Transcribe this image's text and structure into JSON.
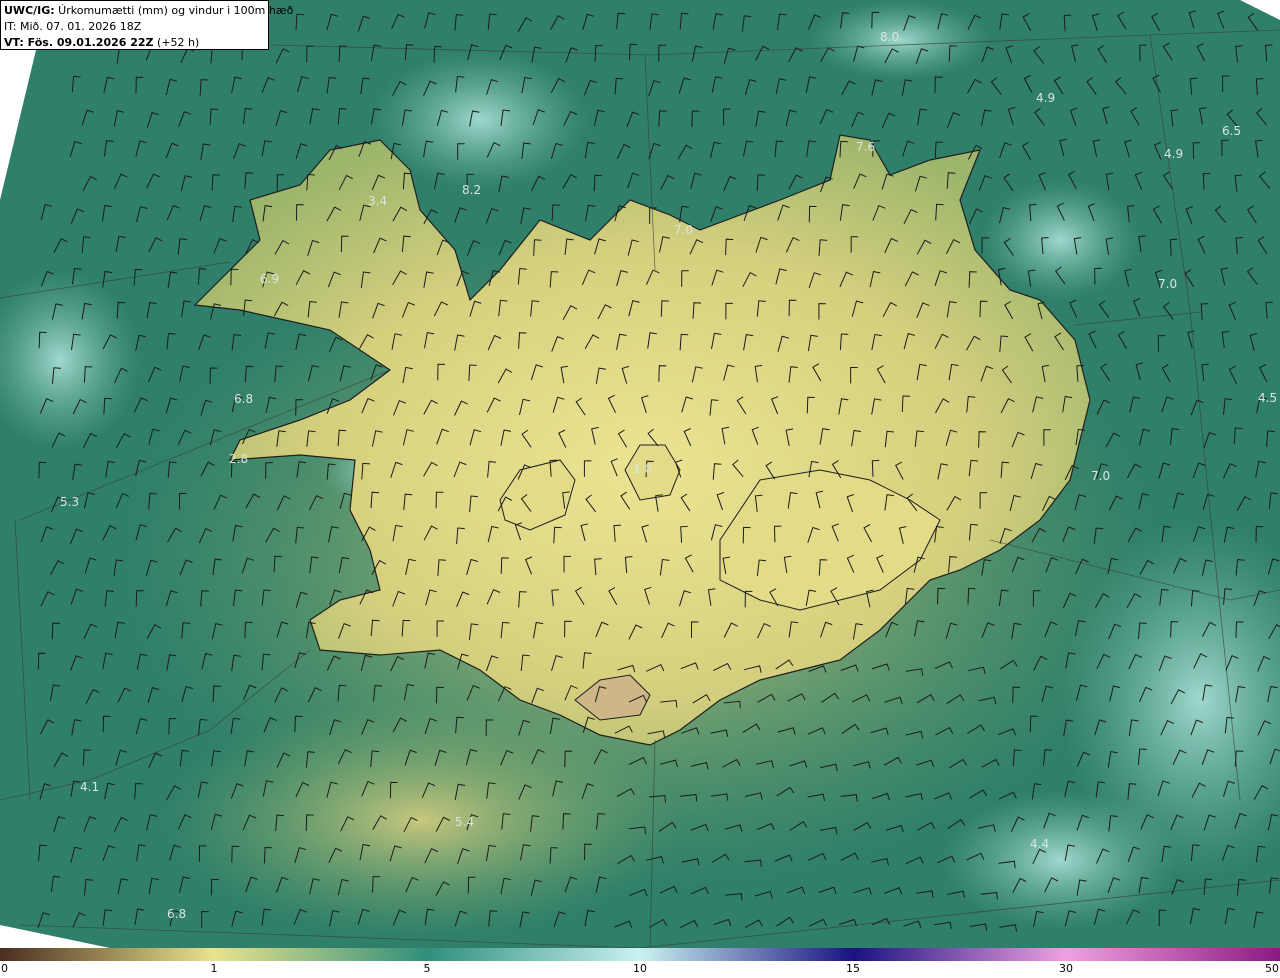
{
  "header": {
    "line1_bold": "UWC/IG:",
    "line1_text": " Úrkomumætti (mm) og vindur i 100m hæð",
    "line2": "IT: Mið. 07. 01. 2026 18Z",
    "line3_bold": "VT: Fös. 09.01.2026 22Z",
    "line3_text": " (+52 h)"
  },
  "colors": {
    "sea": "#2f7f6a",
    "land_low": "#c9c77a",
    "land_high": "#e9e38e",
    "cloud": "#8fd0c4",
    "outline": "#1e1e1e"
  },
  "map_labels": [
    {
      "text": "8.0"
    },
    {
      "text": "4.9"
    },
    {
      "text": "6.5"
    },
    {
      "text": "4.9"
    },
    {
      "text": "7.6"
    },
    {
      "text": "3.4"
    },
    {
      "text": "8.2"
    },
    {
      "text": "7.0"
    },
    {
      "text": "6.9"
    },
    {
      "text": "7.0"
    },
    {
      "text": "6.8"
    },
    {
      "text": "4.5"
    },
    {
      "text": "2.8"
    },
    {
      "text": "1.0"
    },
    {
      "text": "7.0"
    },
    {
      "text": "5.3"
    },
    {
      "text": "4.1"
    },
    {
      "text": "5.4"
    },
    {
      "text": "4.4"
    },
    {
      "text": "6.8"
    }
  ],
  "colorbar": {
    "ticks": [
      "0",
      "1",
      "5",
      "10",
      "15",
      "30",
      "50"
    ],
    "stops": [
      {
        "value": "0",
        "color": "#4a2e1f"
      },
      {
        "value": "1",
        "color": "#e9e38e"
      },
      {
        "value": "5",
        "color": "#2f8f7a"
      },
      {
        "value": "10",
        "color": "#c9f2f0"
      },
      {
        "value": "15",
        "color": "#1a1280"
      },
      {
        "value": "30",
        "color": "#f0a0e0"
      },
      {
        "value": "50",
        "color": "#8a1a80"
      }
    ]
  }
}
